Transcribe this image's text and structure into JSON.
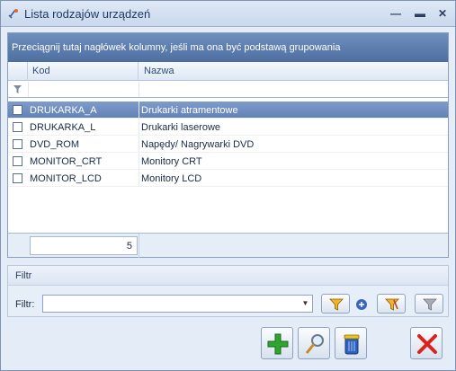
{
  "window": {
    "title": "Lista rodzajów urządzeń",
    "app_icon": "devices-icon",
    "controls": [
      "minimize-icon",
      "maximize-icon",
      "close-icon"
    ]
  },
  "grid": {
    "group_panel_text": "Przeciągnij tutaj nagłówek kolumny, jeśli ma ona być podstawą grupowania",
    "columns": [
      "Kod",
      "Nazwa"
    ],
    "rows": [
      {
        "code": "DRUKARKA_A",
        "name": "Drukarki atramentowe",
        "selected": true
      },
      {
        "code": "DRUKARKA_L",
        "name": "Drukarki laserowe",
        "selected": false
      },
      {
        "code": "DVD_ROM",
        "name": "Napędy/ Nagrywarki DVD",
        "selected": false
      },
      {
        "code": "MONITOR_CRT",
        "name": "Monitory CRT",
        "selected": false
      },
      {
        "code": "MONITOR_LCD",
        "name": "Monitory LCD",
        "selected": false
      }
    ],
    "count": "5"
  },
  "filter": {
    "group_title": "Filtr",
    "label": "Filtr:",
    "value": ""
  },
  "colors": {
    "selection": "#6f8fc2",
    "group_panel": "#5b7db0",
    "add_green": "#2fa52f",
    "delete_red": "#d9231c"
  }
}
